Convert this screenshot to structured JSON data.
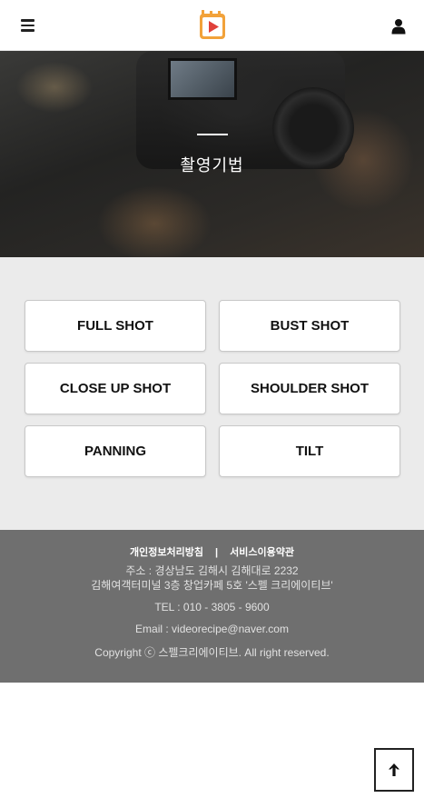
{
  "header": {
    "menu_icon": "hamburger-icon",
    "logo_icon": "video-play-logo",
    "user_icon": "user-icon"
  },
  "hero": {
    "title": "촬영기법"
  },
  "shots": [
    {
      "label": "FULL SHOT"
    },
    {
      "label": "BUST SHOT"
    },
    {
      "label": "CLOSE UP SHOT"
    },
    {
      "label": "SHOULDER SHOT"
    },
    {
      "label": "PANNING"
    },
    {
      "label": "TILT"
    }
  ],
  "footer": {
    "privacy_link": "개인정보처리방침",
    "separator": "|",
    "terms_link": "서비스이용약관",
    "address_line1": "주소 : 경상남도 김해시 김해대로 2232",
    "address_line2": "김해여객터미널 3층 창업카페 5호 '스펠 크리에이티브'",
    "tel": "TEL : 010 - 3805 - 9600",
    "email": "Email : videorecipe@naver.com",
    "copyright": "Copyright ⓒ 스펠크리에이티브. All right reserved."
  },
  "scroll_top_icon": "arrow-up-icon",
  "colors": {
    "logo_orange": "#f2a23a",
    "footer_bg": "#6f6f6f",
    "content_bg": "#ebebeb"
  }
}
